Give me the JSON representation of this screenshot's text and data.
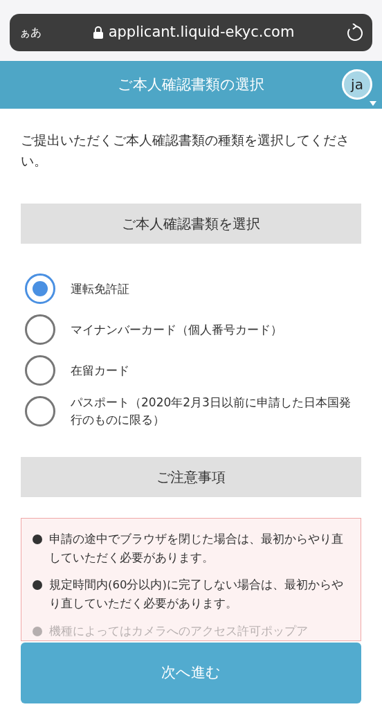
{
  "browser_bar": {
    "text_size_label": "ぁあ",
    "url": "applicant.liquid-ekyc.com"
  },
  "header": {
    "title": "ご本人確認書類の選択",
    "language": "ja"
  },
  "intro": "ご提出いただくご本人確認書類の種類を選択してください。",
  "document_section": {
    "heading": "ご本人確認書類を選択",
    "options": [
      {
        "label": "運転免許証",
        "selected": true
      },
      {
        "label": "マイナンバーカード（個人番号カード）",
        "selected": false
      },
      {
        "label": "在留カード",
        "selected": false
      },
      {
        "label": "パスポート（2020年2月3日以前に申請した日本国発行のものに限る）",
        "selected": false
      }
    ]
  },
  "notes_section": {
    "heading": "ご注意事項",
    "notes": [
      {
        "text": "申請の途中でブラウザを閉じた場合は、最初からやり直していただく必要があります。",
        "faded": false
      },
      {
        "text": "規定時間内(60分以内)に完了しない場合は、最初からやり直していただく必要があります。",
        "faded": false
      },
      {
        "text": "機種によってはカメラへのアクセス許可ポップア",
        "faded": true
      }
    ]
  },
  "next_button": "次へ進む"
}
